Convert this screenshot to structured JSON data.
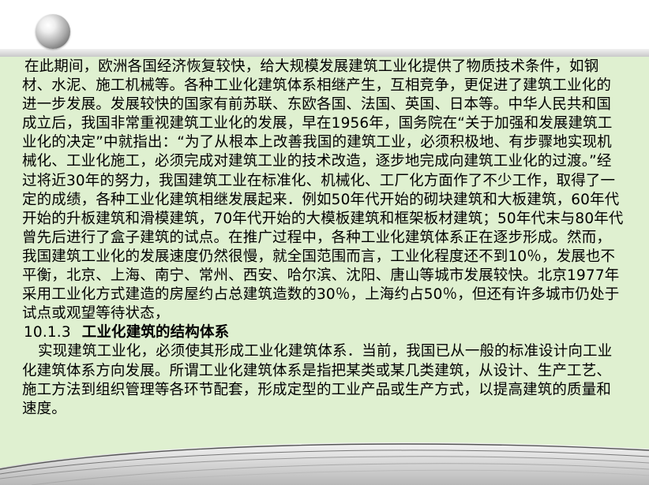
{
  "paragraph1": "在此期间，欧洲各国经济恢复较快，给大规模发展建筑工业化提供了物质技术条件，如钢材、水泥、施工机械等。各种工业化建筑体系相继产生，互相竞争，更促进了建筑工业化的进一步发展。发展较快的国家有前苏联、东欧各国、法国、英国、日本等。中华人民共和国成立后，我国非常重视建筑工业化的发展，早在1956年，国务院在“关于加强和发展建筑工业化的决定”中就指出：“为了从根本上改善我国的建筑工业，必须积极地、有步骤地实现机械化、工业化施工，必须完成对建筑工业的技术改造，逐步地完成向建筑工业化的过渡。”经过将近30年的努力，我国建筑工业在标准化、机械化、工厂化方面作了不少工作，取得了一定的成绩，各种工业化建筑相继发展起来．例如50年代开始的砌块建筑和大板建筑，60年代开始的升板建筑和滑模建筑，70年代开始的大模板建筑和框架板材建筑；50年代末与80年代曾先后进行了盒子建筑的试点。在推广过程中，各种工业化建筑体系正在逐步形成。然而，我国建筑工业化的发展速度仍然很慢，就全国范围而言，工业化程度还不到10％，发展也不平衡，北京、上海、南宁、常州、西安、哈尔滨、沈阳、唐山等城市发展较快。北京1977年采用工业化方式建造的房屋约占总建筑造数的30％，上海约占50％，但还有许多城市仍处于试点或观望等待状态，",
  "section": {
    "number": "10.1.3",
    "title": "工业化建筑的结构体系"
  },
  "paragraph2": "实现建筑工业化，必须使其形成工业化建筑体系．当前，我国已从一般的标准设计向工业化建筑体系方向发展。所谓工业化建筑体系是指把某类或某几类建筑，从设计、生产工艺、施工方法到组织管理等各环节配套，形成定型的工业产品或生产方式，以提高建筑的质量和速度。",
  "colors": {
    "panel_background": "#dff0d0",
    "text": "#000000",
    "stripe": "#c9c9c9"
  },
  "decorations": {
    "top_ornament": "gray-sphere-icon",
    "bottom_ornament": "gray-swoosh-lines"
  }
}
